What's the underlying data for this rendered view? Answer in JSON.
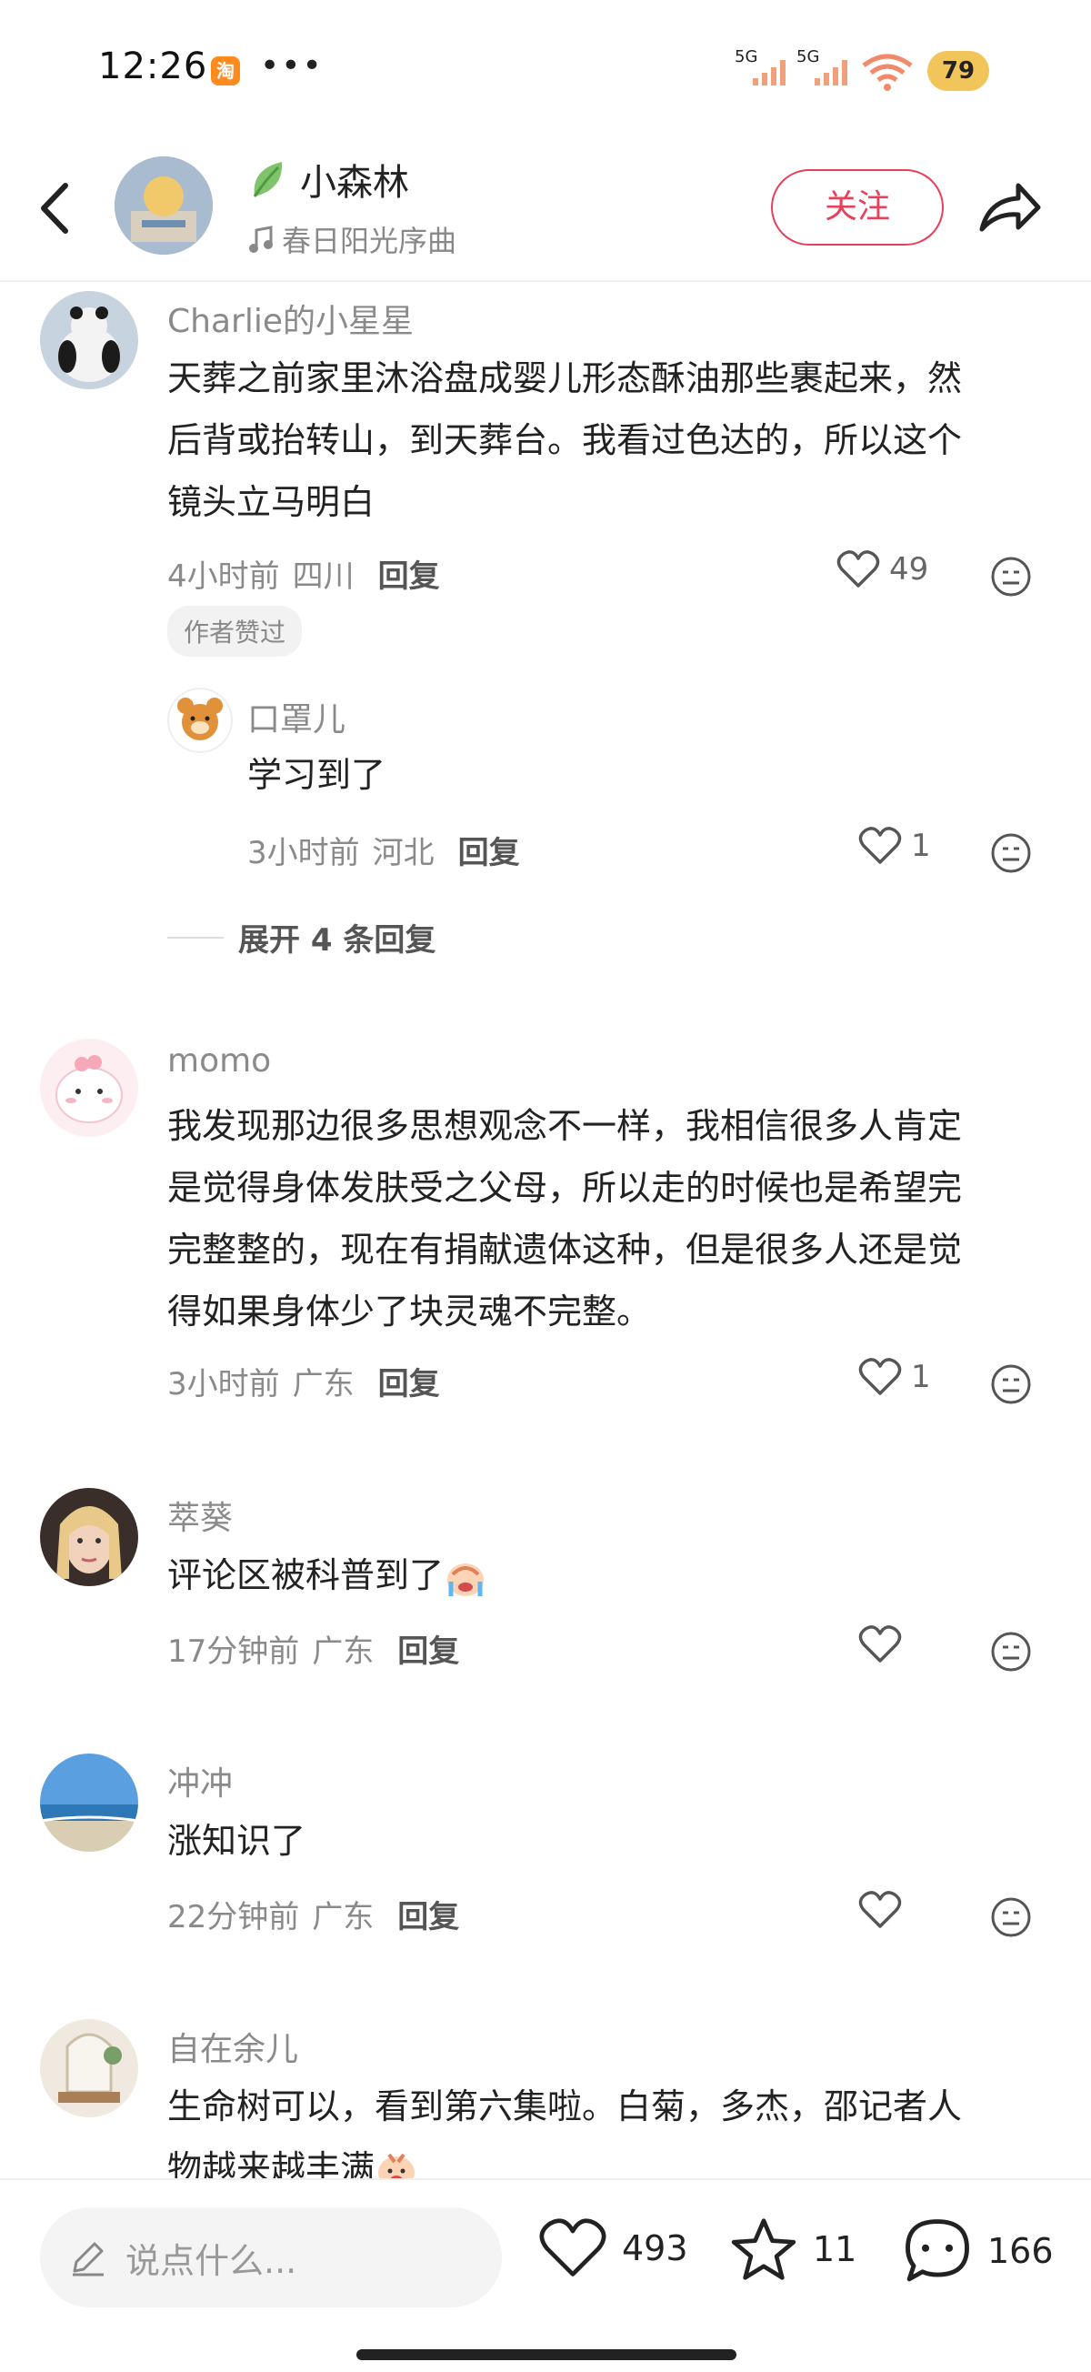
{
  "status": {
    "time": "12:26",
    "app_icon": "淘",
    "more": "•••",
    "signal1": "5G",
    "signal2": "5G",
    "wifi_sub": "7",
    "battery": "79"
  },
  "header": {
    "author_name": "小森林",
    "music": "春日阳光序曲",
    "follow_label": "关注"
  },
  "comments": [
    {
      "user": "Charlie的小星星",
      "text_lines": [
        "天葬之前家里沐浴盘成婴儿形态酥油那些裹起来，然",
        "后背或抬转山，到天葬台。我看过色达的，所以这个",
        "镜头立马明白"
      ],
      "time": "4小时前",
      "location": "四川",
      "reply": "回复",
      "likes": "49",
      "badge": "作者赞过",
      "sub_reply": {
        "user": "口罩儿",
        "text": "学习到了",
        "time": "3小时前",
        "location": "河北",
        "reply": "回复",
        "likes": "1"
      },
      "expand": "展开 4 条回复"
    },
    {
      "user": "momo",
      "text_lines": [
        "我发现那边很多思想观念不一样，我相信很多人肯定",
        "是觉得身体发肤受之父母，所以走的时候也是希望完",
        "完整整的，现在有捐献遗体这种，但是很多人还是觉",
        "得如果身体少了块灵魂不完整。"
      ],
      "time": "3小时前",
      "location": "广东",
      "reply": "回复",
      "likes": "1"
    },
    {
      "user": "萃葵",
      "text": "评论区被科普到了",
      "time": "17分钟前",
      "location": "广东",
      "reply": "回复",
      "likes": ""
    },
    {
      "user": "冲冲",
      "text": "涨知识了",
      "time": "22分钟前",
      "location": "广东",
      "reply": "回复",
      "likes": ""
    },
    {
      "user": "自在余儿",
      "text_lines": [
        "生命树可以，看到第六集啦。白菊，多杰，邵记者人",
        "物越来越丰满"
      ]
    }
  ],
  "bottom": {
    "placeholder": "说点什么...",
    "likes": "493",
    "stars": "11",
    "comments": "166"
  },
  "colors": {
    "accent": "#e8405a",
    "muted": "#8a8a8a"
  }
}
